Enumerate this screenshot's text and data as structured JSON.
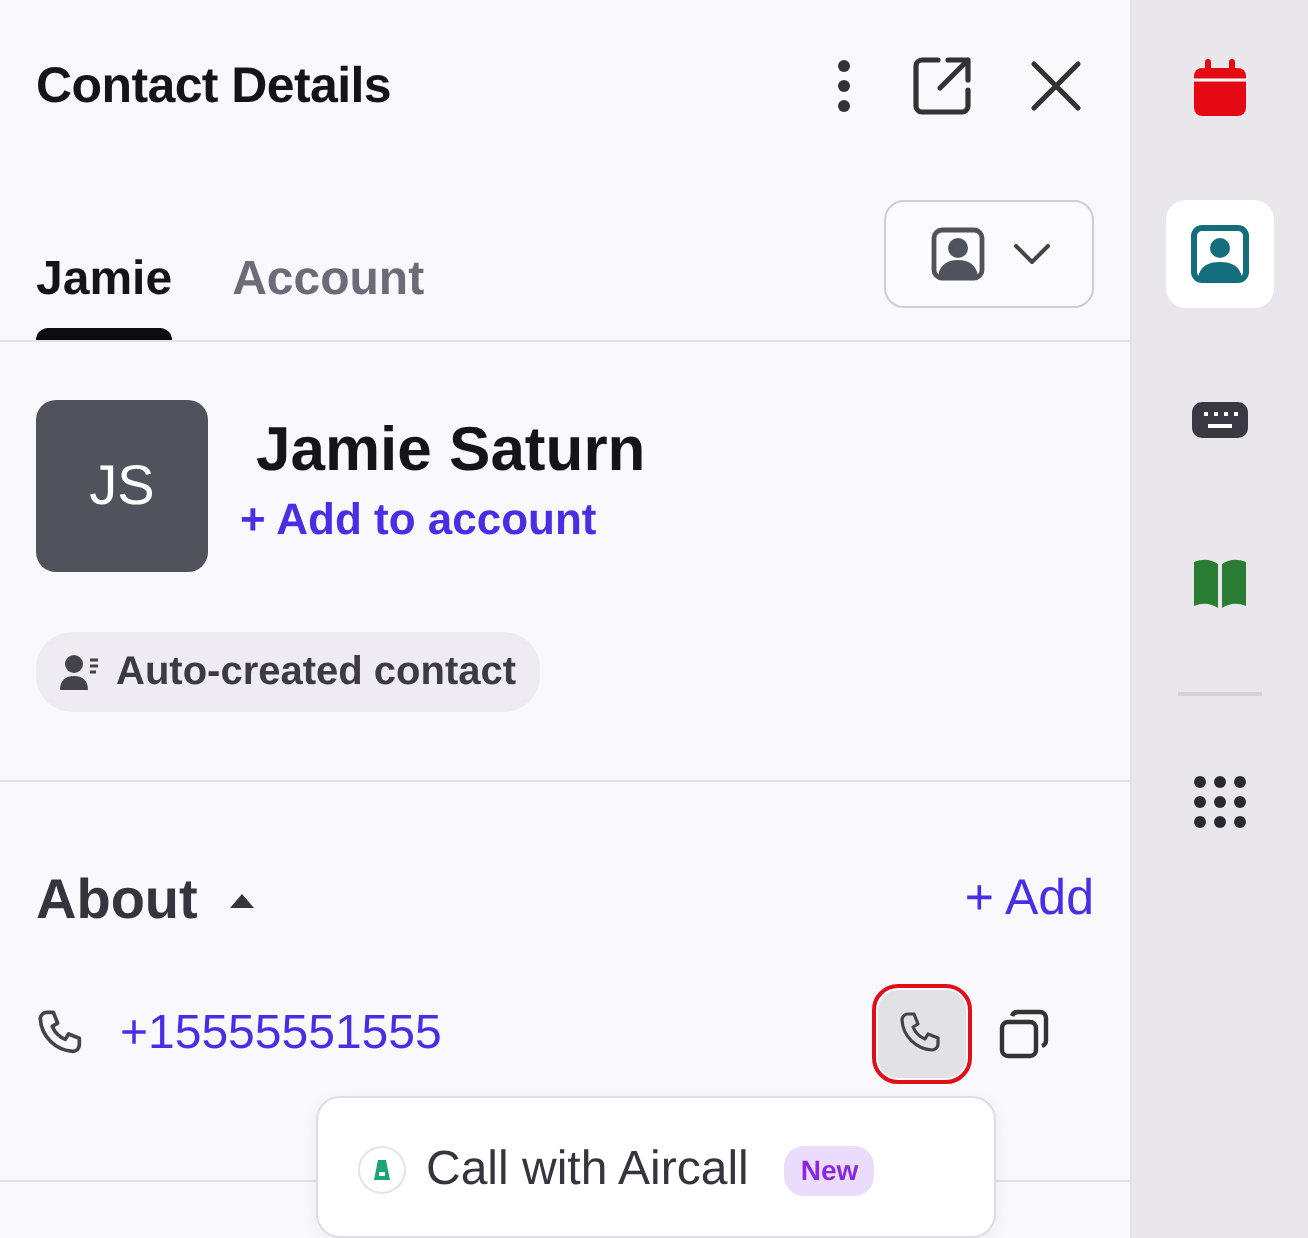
{
  "panel": {
    "title": "Contact Details"
  },
  "tabs": [
    {
      "label": "Jamie",
      "selected": true
    },
    {
      "label": "Account",
      "selected": false
    }
  ],
  "contact": {
    "initials": "JS",
    "name": "Jamie Saturn",
    "add_link": "+ Add to account",
    "chip": "Auto-created contact"
  },
  "about": {
    "title": "About",
    "expanded": true,
    "add_link": "+ Add",
    "phone": "+15555551555",
    "call_highlighted": true
  },
  "call_menu": {
    "items": [
      {
        "label": "Call with Aircall",
        "badge": "New"
      }
    ]
  },
  "rail": [
    {
      "kind": "calendar",
      "selected": false
    },
    {
      "kind": "contact",
      "selected": true
    },
    {
      "kind": "keyboard",
      "selected": false
    },
    {
      "kind": "book",
      "selected": false
    },
    {
      "kind": "divider"
    },
    {
      "kind": "apps",
      "selected": false
    }
  ]
}
